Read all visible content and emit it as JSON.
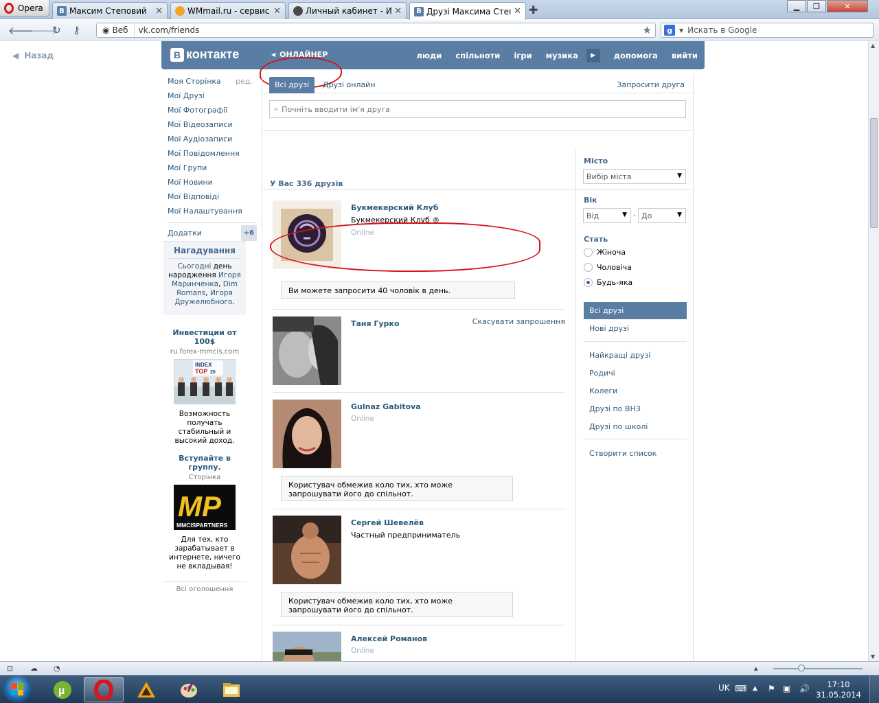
{
  "browser": {
    "menu_label": "Opera",
    "tabs": [
      {
        "label": "Максим Степовий",
        "icon": "vk"
      },
      {
        "label": "WMmail.ru - сервис п...",
        "icon": "wm"
      },
      {
        "label": "Личный кабинет - Ис...",
        "icon": "ie"
      },
      {
        "label": "Друзі Максима Степо...",
        "icon": "vk"
      }
    ],
    "web_label": "Веб",
    "url": "vk.com/friends",
    "search_placeholder": "Искать в Google"
  },
  "page": {
    "back_label": "Назад",
    "header": {
      "logo_text": "контакте",
      "logo_letter": "В",
      "online_label": "ОНЛАЙНЕР",
      "nav": [
        "люди",
        "спільноти",
        "ігри",
        "музика",
        "допомога",
        "вийти"
      ]
    },
    "left_menu": {
      "items": [
        "Моя Сторінка",
        "Мої Друзі",
        "Мої Фотографії",
        "Мої Відеозаписи",
        "Мої Аудіозаписи",
        "Мої Повідомлення",
        "Мої Групи",
        "Мої Новини",
        "Мої Відповіді",
        "Мої Налаштування"
      ],
      "edit_label": "ред.",
      "apps_label": "Додатки",
      "apps_badge": "+6"
    },
    "reminder": {
      "title": "Нагадування",
      "today": "Сьогодні",
      "text_mid": "день народження",
      "name1": "Игоря Маринченка",
      "comma": ",",
      "name2": "Dim Romans",
      "comma2": ",",
      "name3": "Игоря Дружелюбного",
      "dot": "."
    },
    "ads": [
      {
        "title": "Инвестиции от 100$",
        "sub": "ru.forex-mmcis.com",
        "text": "Возможность получать стабильный и высокий доход."
      },
      {
        "title": "Вступайте в группу.",
        "sub": "Сторінка",
        "text": "Для тех, кто зарабатывает в интернете, ничего не вкладывая!",
        "logo_text": "MP",
        "logo_sub": "MMCISPARTNERS"
      }
    ],
    "ad1_img_text": {
      "line1": "INDEX",
      "line2": "TOP",
      "line3": "20"
    },
    "all_ads_label": "Всі оголошення",
    "tabs": {
      "all": "Всі друзі",
      "online": "Друзі онлайн",
      "invite": "Запросити друга"
    },
    "search_placeholder": "Почніть вводити ім'я друга",
    "count_label": "У Вас 336 друзів",
    "friends": [
      {
        "name": "Букмекерский Клуб",
        "sub": "Букмекерский Клуб ®",
        "status": "Online"
      },
      {
        "name": "Таня Гурко",
        "action": "Скасувати запрошення"
      },
      {
        "name": "Gulnaz Gabitova",
        "status": "Online"
      },
      {
        "name": "Сергей Шевелёв",
        "sub": "Частный предприниматель"
      },
      {
        "name": "Алексей Романов",
        "status": "Online"
      }
    ],
    "notice_invite": "Ви можете запросити 40 чоловік в день.",
    "notice_restrict": "Користувач обмежив коло тих, хто може запрошувати його до спільнот.",
    "filters": {
      "city_label": "Місто",
      "city_value": "Вибір міста",
      "age_label": "Вік",
      "age_from": "Від",
      "age_dash": "-",
      "age_to": "До",
      "sex_label": "Стать",
      "sex_options": [
        "Жіноча",
        "Чоловіча",
        "Будь-яка"
      ],
      "lists_top": [
        "Всі друзі",
        "Нові друзі"
      ],
      "lists": [
        "Найкращі друзі",
        "Родичі",
        "Колеги",
        "Друзі по ВНЗ",
        "Друзі по школі"
      ],
      "create_list": "Створити список"
    }
  },
  "taskbar": {
    "lang": "UK",
    "time": "17:10",
    "date": "31.05.2014"
  },
  "colors": {
    "vk_blue": "#597da3",
    "link": "#2b587a",
    "annotation_red": "#d8121b"
  }
}
